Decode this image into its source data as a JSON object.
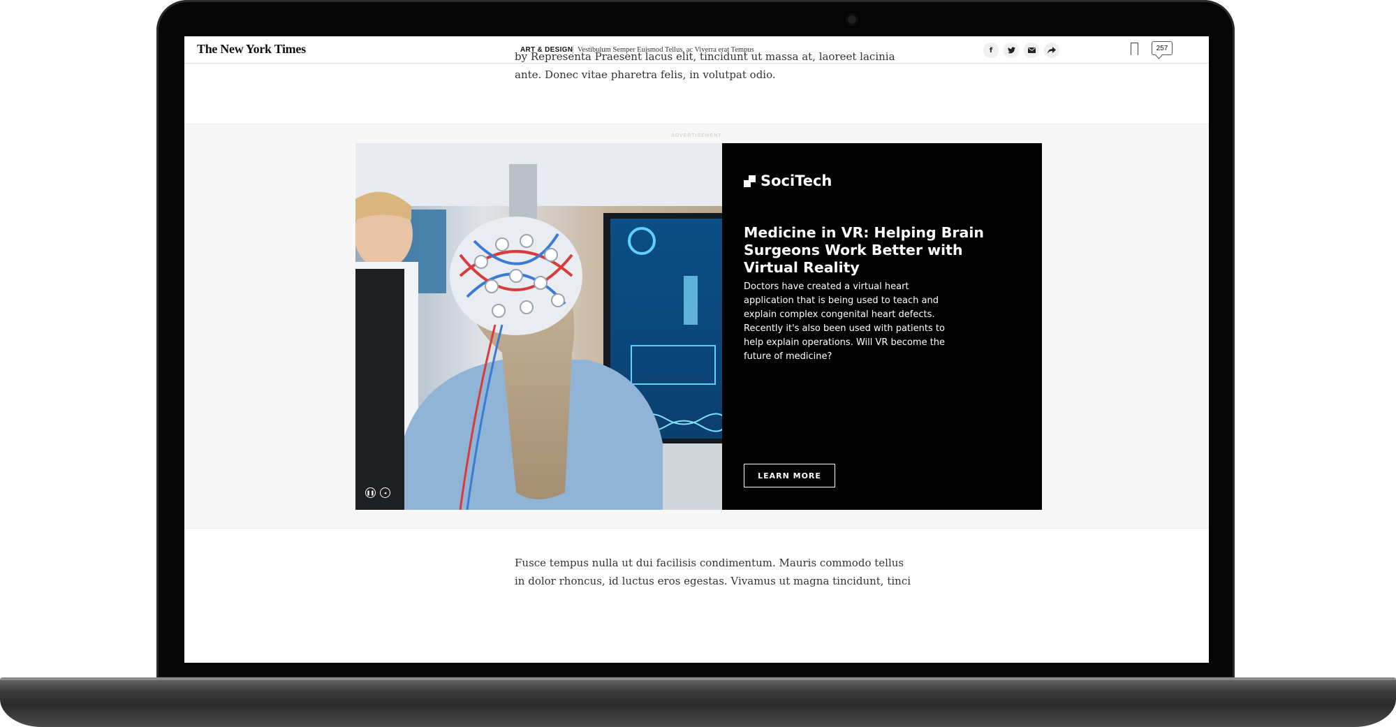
{
  "header": {
    "logo": "The New York Times",
    "section": "ART & DESIGN",
    "headline": "Vestibulum Semper Euismod Tellus, ac Viverra erat Tempus",
    "share": {
      "facebook_icon": "f",
      "twitter_icon": "twitter-bird",
      "email_icon": "envelope",
      "share_icon": "share-arrow"
    },
    "comment_count": "257"
  },
  "article": {
    "para_top_line1": "by Representa Praesent lacus elit, tincidunt ut massa at, laoreet lacinia",
    "para_top_line2": "ante. Donec vitae pharetra felis, in volutpat odio.",
    "para_bottom_line1": "Fusce tempus nulla ut dui facilisis condimentum. Mauris commodo tellus",
    "para_bottom_line2": "in dolor rhoncus, id luctus eros egestas. Vivamus ut magna tincidunt, tinci"
  },
  "ad": {
    "label": "ADVERTISEMENT",
    "brand": "SociTech",
    "title": "Medicine in VR: Helping Brain Surgeons Work Better with Virtual Reality",
    "description": "Doctors have created a virtual heart application that is being used to teach and explain complex congenital heart defects. Recently it's also been used with patients to help explain operations. Will VR become the future of medicine?",
    "cta": "LEARN MORE",
    "pause_icon": "pause",
    "mute_icon": "speaker"
  },
  "colors": {
    "ad_background": "#000000",
    "ad_text": "#ffffff",
    "band_background": "#f7f7f7",
    "body_text": "#333333"
  }
}
